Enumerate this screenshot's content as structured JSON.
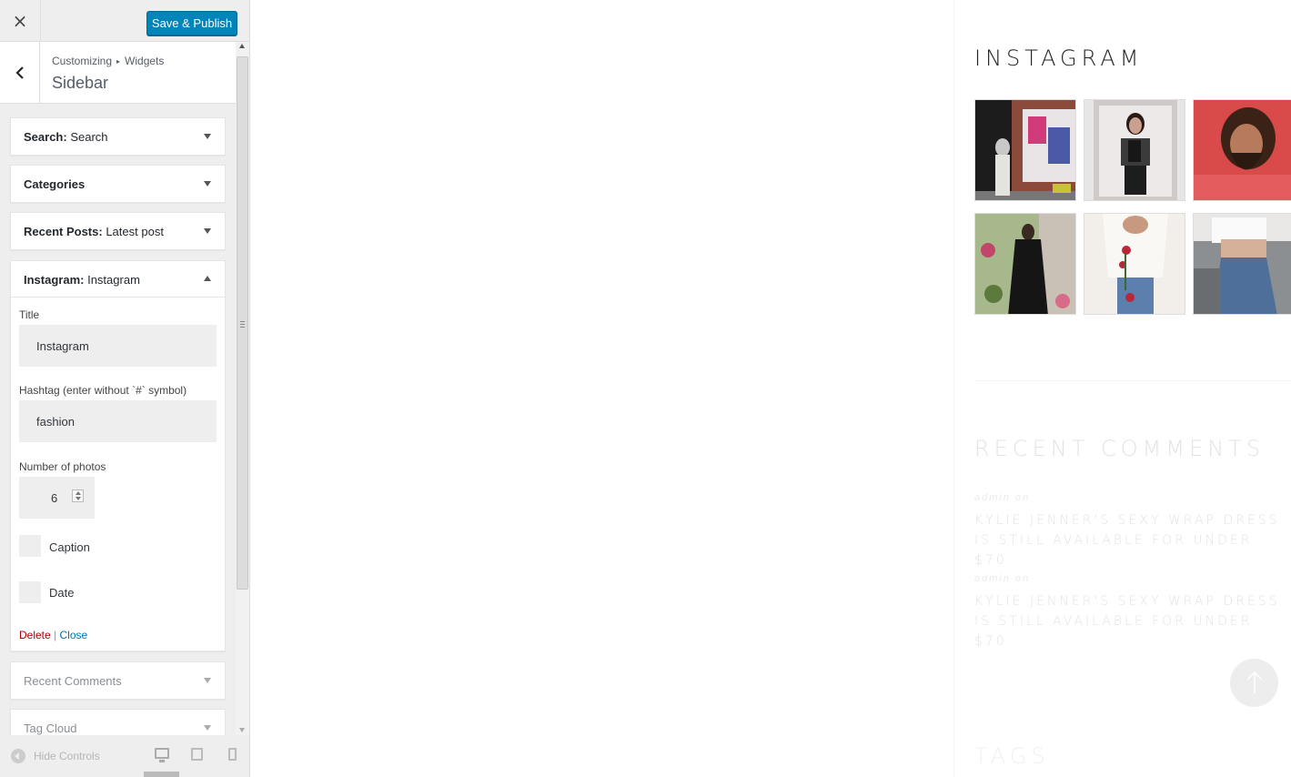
{
  "topbar": {
    "close_icon": "×",
    "publish_label": "Save & Publish"
  },
  "section": {
    "crumb_1": "Customizing",
    "crumb_sep": "▸",
    "crumb_2": "Widgets",
    "title": "Sidebar"
  },
  "widgets": {
    "search": {
      "type": "Search:",
      "name": "Search"
    },
    "categories": {
      "type": "Categories",
      "name": ""
    },
    "recent_posts": {
      "type": "Recent Posts:",
      "name": "Latest post"
    },
    "instagram": {
      "type": "Instagram:",
      "name": "Instagram"
    },
    "recent_comments": {
      "type": "Recent Comments",
      "name": ""
    },
    "tag_cloud": {
      "type": "Tag Cloud",
      "name": ""
    }
  },
  "instagram_form": {
    "title_label": "Title",
    "title_value": "Instagram",
    "hashtag_label": "Hashtag (enter without `#` symbol)",
    "hashtag_value": "fashion",
    "photos_label": "Number of photos",
    "photos_value": "6",
    "caption_label": "Caption",
    "caption_checked": false,
    "date_label": "Date",
    "date_checked": false,
    "delete_label": "Delete",
    "action_sep": "|",
    "close_label": "Close"
  },
  "footer": {
    "hide_controls_label": "Hide Controls",
    "devices": [
      "desktop-icon",
      "tablet-icon",
      "mobile-icon"
    ],
    "active_device": "desktop"
  },
  "preview": {
    "instagram_title": "INSTAGRAM",
    "photo_count": 6,
    "recent_comments_title": "RECENT COMMENTS",
    "comments": [
      {
        "meta": "admin  on",
        "link": "KYLIE JENNER'S SEXY WRAP DRESS IS STILL AVAILABLE FOR UNDER $70"
      },
      {
        "meta": "admin  on",
        "link": "KYLIE JENNER'S SEXY WRAP DRESS IS STILL AVAILABLE FOR UNDER $70"
      }
    ],
    "tags_title": "TAGS"
  },
  "colors": {
    "accent": "#0085ba",
    "delete": "#aa0000",
    "link": "#0073aa",
    "panel_bg": "#eeeeee"
  }
}
